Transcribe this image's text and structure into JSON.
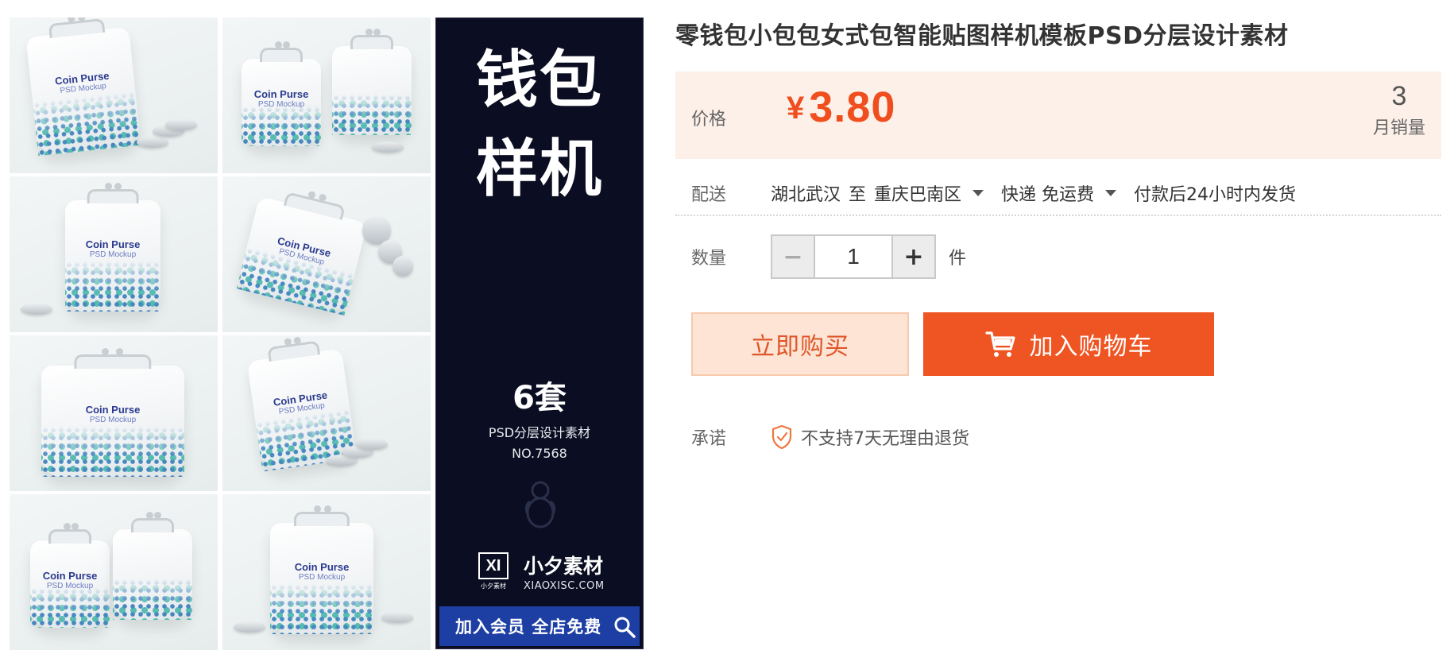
{
  "gallery": {
    "thumbnails": [
      {
        "name": "Coin Purse",
        "sub": "PSD Mockup"
      },
      {
        "name": "Coin Purse",
        "sub": "PSD Mockup"
      },
      {
        "name": "Coin Purse",
        "sub": "PSD Mockup"
      },
      {
        "name": "Coin Purse",
        "sub": "PSD Mockup"
      },
      {
        "name": "Coin Purse",
        "sub": "PSD Mockup"
      },
      {
        "name": "Coin Purse",
        "sub": "PSD Mockup"
      },
      {
        "name": "Coin Purse",
        "sub": "PSD Mockup"
      },
      {
        "name": "Coin Purse",
        "sub": "PSD Mockup"
      }
    ],
    "banner": {
      "headline_line1": "钱包",
      "headline_line2": "样机",
      "sets": "6套",
      "subtitle": "PSD分层设计素材",
      "code": "NO.7568",
      "brand_logo": "XI",
      "brand_logo_caption": "小夕素材",
      "brand_name": "小夕素材",
      "brand_url": "XIAOXISC.COM",
      "join_text": "加入会员 全店免费",
      "zoom_icon": "magnifier-icon"
    }
  },
  "product": {
    "title": "零钱包小包包女式包智能贴图样机模板PSD分层设计素材",
    "price_label": "价格",
    "currency": "¥",
    "price": "3.80",
    "monthly_sales": "3",
    "monthly_sales_label": "月销量",
    "shipping": {
      "label": "配送",
      "from": "湖北武汉",
      "to_word": "至",
      "destination": "重庆巴南区",
      "method": "快递 免运费",
      "dispatch": "付款后24小时内发货"
    },
    "quantity": {
      "label": "数量",
      "value": "1",
      "minus": "−",
      "plus": "+",
      "unit": "件"
    },
    "buttons": {
      "buy_now": "立即购买",
      "add_to_cart": "加入购物车"
    },
    "promise": {
      "label": "承诺",
      "text": "不支持7天无理由退货"
    }
  },
  "colors": {
    "accent": "#ef5423",
    "price": "#f04e1e",
    "price_bg": "#fcf0e8",
    "banner_bg": "#0b0e22",
    "join_bar": "#1d3fa4"
  }
}
